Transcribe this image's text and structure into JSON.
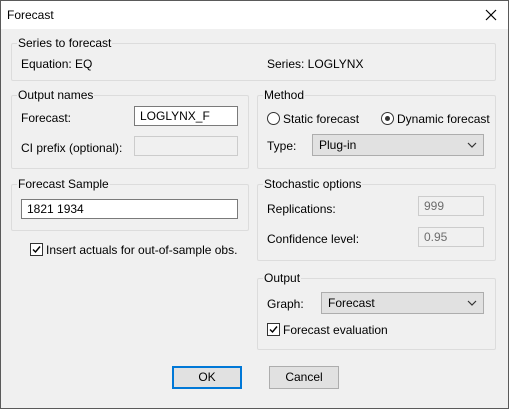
{
  "window": {
    "title": "Forecast"
  },
  "series_group": {
    "legend": "Series to forecast",
    "equation": "Equation: EQ",
    "series": "Series: LOGLYNX"
  },
  "output_names": {
    "legend": "Output names",
    "forecast_label": "Forecast:",
    "forecast_value": "LOGLYNX_F",
    "ci_label": "CI prefix (optional):",
    "ci_value": ""
  },
  "method": {
    "legend": "Method",
    "static_label": "Static forecast",
    "dynamic_label": "Dynamic forecast",
    "selected": "dynamic",
    "type_label": "Type:",
    "type_value": "Plug-in"
  },
  "sample": {
    "legend": "Forecast Sample",
    "value": "1821 1934",
    "insert_actuals_label": "Insert actuals for out-of-sample obs.",
    "insert_actuals_checked": true
  },
  "stochastic": {
    "legend": "Stochastic options",
    "replications_label": "Replications:",
    "replications_value": "999",
    "confidence_label": "Confidence level:",
    "confidence_value": "0.95"
  },
  "output": {
    "legend": "Output",
    "graph_label": "Graph:",
    "graph_value": "Forecast",
    "evaluation_label": "Forecast evaluation",
    "evaluation_checked": true
  },
  "buttons": {
    "ok": "OK",
    "cancel": "Cancel"
  }
}
